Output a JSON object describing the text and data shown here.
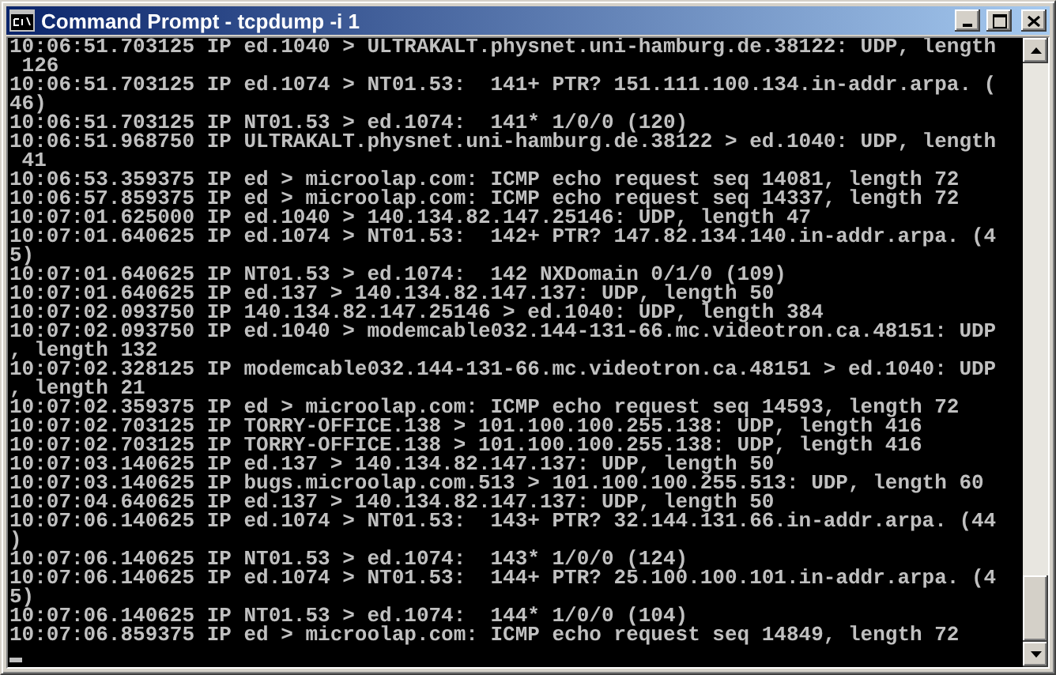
{
  "window": {
    "title": "Command Prompt - tcpdump -i 1"
  },
  "console": {
    "lines": [
      "10:06:51.703125 IP ed.1040 > ULTRAKALT.physnet.uni-hamburg.de.38122: UDP, length",
      " 126",
      "10:06:51.703125 IP ed.1074 > NT01.53:  141+ PTR? 151.111.100.134.in-addr.arpa. (",
      "46)",
      "10:06:51.703125 IP NT01.53 > ed.1074:  141* 1/0/0 (120)",
      "10:06:51.968750 IP ULTRAKALT.physnet.uni-hamburg.de.38122 > ed.1040: UDP, length",
      " 41",
      "10:06:53.359375 IP ed > microolap.com: ICMP echo request seq 14081, length 72",
      "10:06:57.859375 IP ed > microolap.com: ICMP echo request seq 14337, length 72",
      "10:07:01.625000 IP ed.1040 > 140.134.82.147.25146: UDP, length 47",
      "10:07:01.640625 IP ed.1074 > NT01.53:  142+ PTR? 147.82.134.140.in-addr.arpa. (4",
      "5)",
      "10:07:01.640625 IP NT01.53 > ed.1074:  142 NXDomain 0/1/0 (109)",
      "10:07:01.640625 IP ed.137 > 140.134.82.147.137: UDP, length 50",
      "10:07:02.093750 IP 140.134.82.147.25146 > ed.1040: UDP, length 384",
      "10:07:02.093750 IP ed.1040 > modemcable032.144-131-66.mc.videotron.ca.48151: UDP",
      ", length 132",
      "10:07:02.328125 IP modemcable032.144-131-66.mc.videotron.ca.48151 > ed.1040: UDP",
      ", length 21",
      "10:07:02.359375 IP ed > microolap.com: ICMP echo request seq 14593, length 72",
      "10:07:02.703125 IP TORRY-OFFICE.138 > 101.100.100.255.138: UDP, length 416",
      "10:07:02.703125 IP TORRY-OFFICE.138 > 101.100.100.255.138: UDP, length 416",
      "10:07:03.140625 IP ed.137 > 140.134.82.147.137: UDP, length 50",
      "10:07:03.140625 IP bugs.microolap.com.513 > 101.100.100.255.513: UDP, length 60",
      "10:07:04.640625 IP ed.137 > 140.134.82.147.137: UDP, length 50",
      "10:07:06.140625 IP ed.1074 > NT01.53:  143+ PTR? 32.144.131.66.in-addr.arpa. (44",
      ")",
      "10:07:06.140625 IP NT01.53 > ed.1074:  143* 1/0/0 (124)",
      "10:07:06.140625 IP ed.1074 > NT01.53:  144+ PTR? 25.100.100.101.in-addr.arpa. (4",
      "5)",
      "10:07:06.140625 IP NT01.53 > ed.1074:  144* 1/0/0 (104)",
      "10:07:06.859375 IP ed > microolap.com: ICMP echo request seq 14849, length 72"
    ]
  }
}
